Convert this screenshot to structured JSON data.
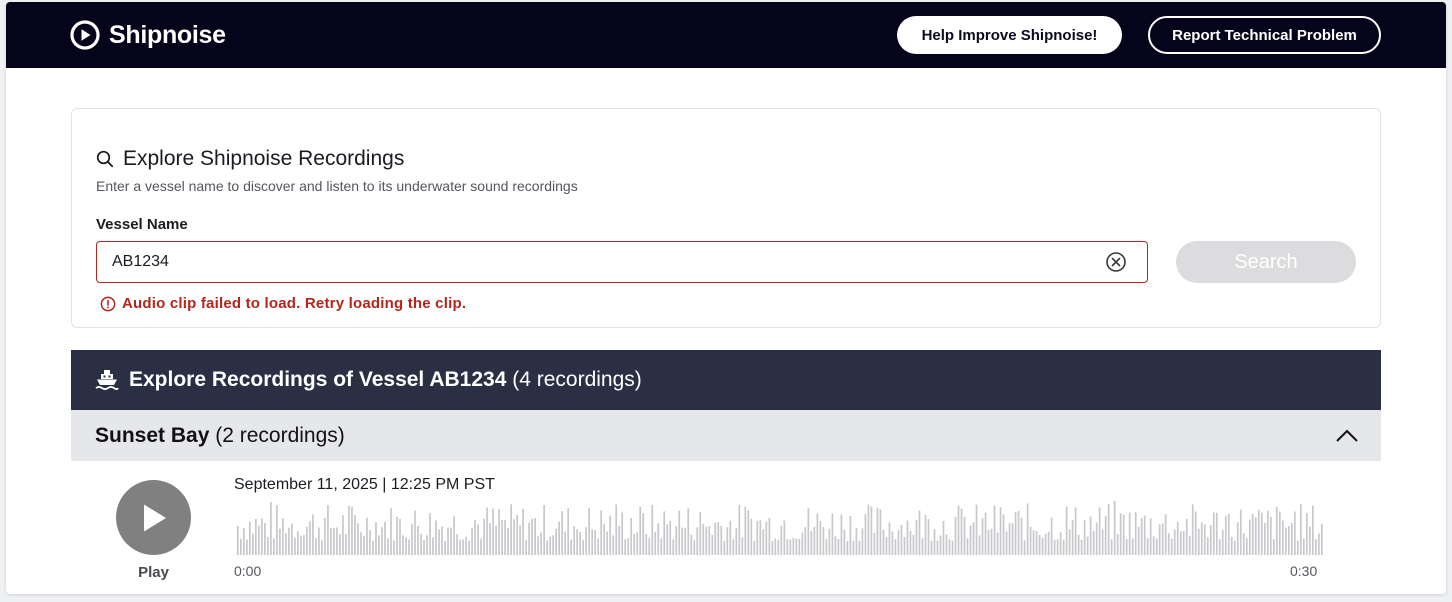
{
  "header": {
    "brand": "Shipnoise",
    "help_button": "Help Improve Shipnoise!",
    "report_button": "Report Technical Problem"
  },
  "search_card": {
    "title": "Explore Shipnoise Recordings",
    "subtitle": "Enter a vessel name to discover and listen to its underwater sound recordings",
    "field_label": "Vessel Name",
    "input_value": "AB1234",
    "error_message": "Audio clip failed to load. Retry loading the clip.",
    "search_button": "Search"
  },
  "results": {
    "title_prefix": "Explore Recordings of Vessel AB1234",
    "title_count": "(4 recordings)"
  },
  "group": {
    "name": "Sunset Bay",
    "count": "(2 recordings)"
  },
  "recording": {
    "datetime": "September 11, 2025 | 12:25 PM PST",
    "play_label": "Play",
    "time_start": "0:00",
    "time_end": "0:30"
  },
  "colors": {
    "topbar": "#05041a",
    "results_bar": "#2b2f44",
    "group_bar": "#e6e7eb",
    "error": "#b3261e",
    "waveform": "#c8c8cc",
    "play_button": "#808080"
  }
}
